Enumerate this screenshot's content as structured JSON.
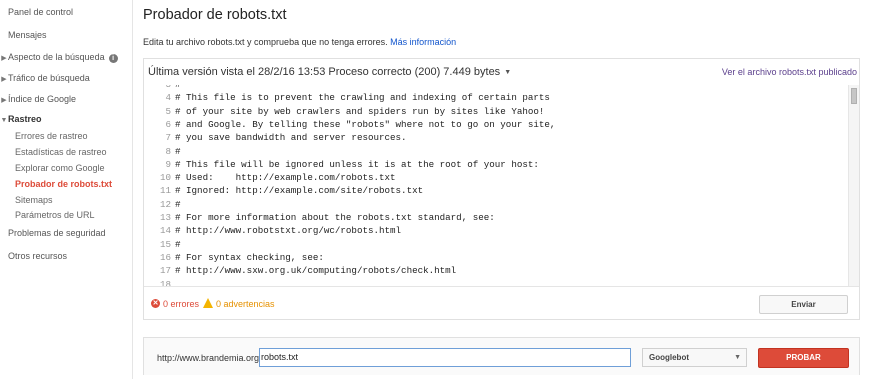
{
  "sidebar": {
    "items": [
      {
        "label": "Panel de control"
      },
      {
        "label": "Mensajes"
      },
      {
        "label": "Aspecto de la búsqueda",
        "arrow": "▶",
        "info": "i"
      },
      {
        "label": "Tráfico de búsqueda",
        "arrow": "▶"
      },
      {
        "label": "Índice de Google",
        "arrow": "▶"
      },
      {
        "label": "Rastreo",
        "arrow": "▼"
      },
      {
        "label": "Errores de rastreo"
      },
      {
        "label": "Estadísticas de rastreo"
      },
      {
        "label": "Explorar como Google"
      },
      {
        "label": "Probador de robots.txt"
      },
      {
        "label": "Sitemaps"
      },
      {
        "label": "Parámetros de URL"
      },
      {
        "label": "Problemas de seguridad"
      },
      {
        "label": "Otros recursos"
      }
    ]
  },
  "page": {
    "title": "Probador de robots.txt",
    "subtitle": "Edita tu archivo robots.txt y comprueba que no tenga errores.",
    "more_info": "Más información"
  },
  "panel": {
    "version_text": "Última versión vista el 28/2/16 13:53 Proceso correcto (200) 7.449 bytes",
    "caret": "▼",
    "view_published": "Ver el archivo robots.txt publicado"
  },
  "editor": {
    "lines": [
      {
        "num": "3",
        "text": "#"
      },
      {
        "num": "4",
        "text": "# This file is to prevent the crawling and indexing of certain parts"
      },
      {
        "num": "5",
        "text": "# of your site by web crawlers and spiders run by sites like Yahoo!"
      },
      {
        "num": "6",
        "text": "# and Google. By telling these \"robots\" where not to go on your site,"
      },
      {
        "num": "7",
        "text": "# you save bandwidth and server resources."
      },
      {
        "num": "8",
        "text": "#"
      },
      {
        "num": "9",
        "text": "# This file will be ignored unless it is at the root of your host:"
      },
      {
        "num": "10",
        "text": "# Used:    http://example.com/robots.txt"
      },
      {
        "num": "11",
        "text": "# Ignored: http://example.com/site/robots.txt"
      },
      {
        "num": "12",
        "text": "#"
      },
      {
        "num": "13",
        "text": "# For more information about the robots.txt standard, see:"
      },
      {
        "num": "14",
        "text": "# http://www.robotstxt.org/wc/robots.html"
      },
      {
        "num": "15",
        "text": "#"
      },
      {
        "num": "16",
        "text": "# For syntax checking, see:"
      },
      {
        "num": "17",
        "text": "# http://www.sxw.org.uk/computing/robots/check.html"
      },
      {
        "num": "18",
        "text": ""
      }
    ]
  },
  "status": {
    "errors": "0 errores",
    "warnings": "0 advertencias",
    "submit_label": "Enviar",
    "error_icon": "x-circle-icon",
    "warning_icon": "warning-triangle-icon"
  },
  "tester": {
    "url_prefix": "http://www.brandemia.org/",
    "url_value": "robots.txt",
    "bot_selected": "Googlebot",
    "test_label": "PROBAR"
  },
  "colors": {
    "accent_red": "#dd4b39",
    "link_blue": "#1155cc",
    "link_purple": "#5b3f8c",
    "warning_orange": "#f4b400"
  }
}
